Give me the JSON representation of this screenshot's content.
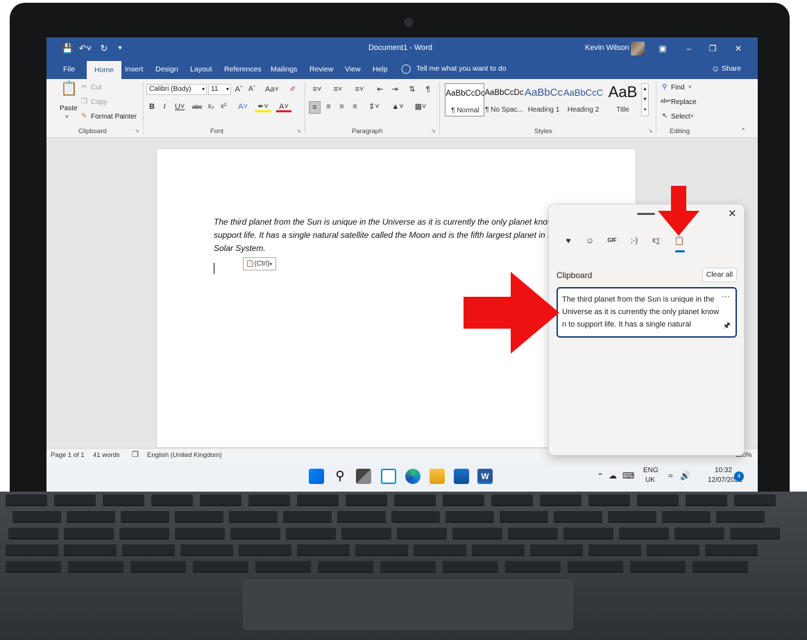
{
  "word": {
    "title": "Document1  -  Word",
    "user_name": "Kevin Wilson",
    "tell_me": "Tell me what you want to do",
    "share": "Share",
    "tabs": [
      "File",
      "Home",
      "Insert",
      "Design",
      "Layout",
      "References",
      "Mailings",
      "Review",
      "View",
      "Help"
    ],
    "ribbon": {
      "clipboard": {
        "paste": "Paste",
        "cut": "Cut",
        "copy": "Copy",
        "format_painter": "Format Painter",
        "label": "Clipboard"
      },
      "font": {
        "name": "Calibri (Body)",
        "size": "11",
        "label": "Font"
      },
      "paragraph": {
        "label": "Paragraph"
      },
      "styles": {
        "label": "Styles",
        "items": [
          {
            "preview": "AaBbCcDc",
            "name": "¶ Normal"
          },
          {
            "preview": "AaBbCcDc",
            "name": "¶ No Spac..."
          },
          {
            "preview": "AaBbCc",
            "name": "Heading 1"
          },
          {
            "preview": "AaBbCcC",
            "name": "Heading 2"
          },
          {
            "preview": "AaB",
            "name": "Title"
          }
        ]
      },
      "editing": {
        "find": "Find",
        "replace": "Replace",
        "select": "Select",
        "label": "Editing"
      }
    },
    "document": {
      "text": "The third planet from the Sun is unique in the Universe as it is currently the only planet known to support life. It has a single natural satellite called the Moon and is the fifth largest planet in the Solar System.",
      "paste_options": "(Ctrl)"
    },
    "status": {
      "page": "Page 1 of 1",
      "words": "41 words",
      "language": "English (United Kingdom)",
      "zoom": "110%"
    }
  },
  "taskbar": {
    "lang_top": "ENG",
    "lang_bottom": "UK",
    "time": "10:32",
    "date": "12/07/2021",
    "notifications": "4"
  },
  "clipboard_panel": {
    "heading": "Clipboard",
    "clear_all": "Clear all",
    "item_text": "The third planet from the Sun is unique in the Universe as it is currently the only planet known to support life. It has a single natural",
    "more": "···",
    "tabs": [
      "emoji-sticker-icon",
      "emoji-icon",
      "gif-icon",
      "kaomoji-icon",
      "symbols-icon",
      "clipboard-history-icon"
    ]
  },
  "colors": {
    "word_blue": "#2b579a",
    "arrow_red": "#ee1111",
    "accent": "#0067c0"
  }
}
